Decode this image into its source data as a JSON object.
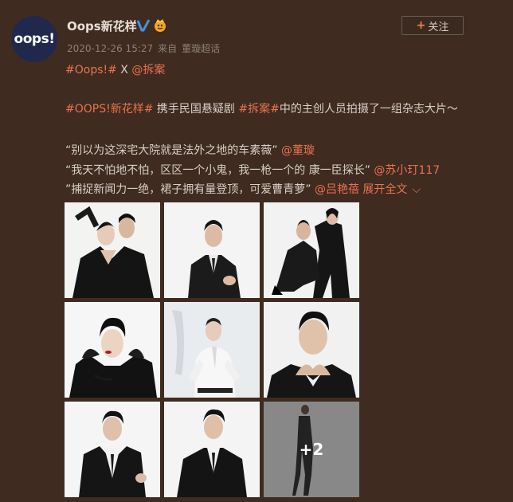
{
  "post": {
    "avatar_text": "oops!",
    "user_name": "Oops新花样",
    "timestamp": "2020-12-26 15:27",
    "source_prefix": "来自",
    "source": "董璇超话",
    "follow_label": "关注",
    "follow_plus": "+",
    "line1": {
      "tag": "#Oops!#",
      "sep": " X ",
      "mention": "@拆案"
    },
    "line2": {
      "tag1": "#OOPS!新花样#",
      "text1": " 携手民国悬疑剧 ",
      "tag2": "#拆案#",
      "text2": "中的主创人员拍摄了一组杂志大片～"
    },
    "line3": {
      "text": "“别以为这深宅大院就是法外之地的车素薇” ",
      "mention": "@董璇"
    },
    "line4": {
      "text": "“我天不怕地不怕，区区一个小鬼，我一枪一个的 康一臣探长” ",
      "mention": "@苏小玎117"
    },
    "line5": {
      "text": "”捕捉新闻力一绝，裙子拥有量登顶，可爱曹青萝” ",
      "mention": "@吕艳蓓",
      "expand": " 展开全文",
      "chevron": "⌵"
    },
    "more_count": "+2",
    "photo_count": 9
  },
  "colors": {
    "background": "#3f2b20",
    "link": "#eb7350",
    "text": "#d8d0c8",
    "meta": "#8d8178",
    "accent": "#ff8140"
  },
  "icons": [
    "verified-icon",
    "vip-icon",
    "chevron-down-icon"
  ]
}
